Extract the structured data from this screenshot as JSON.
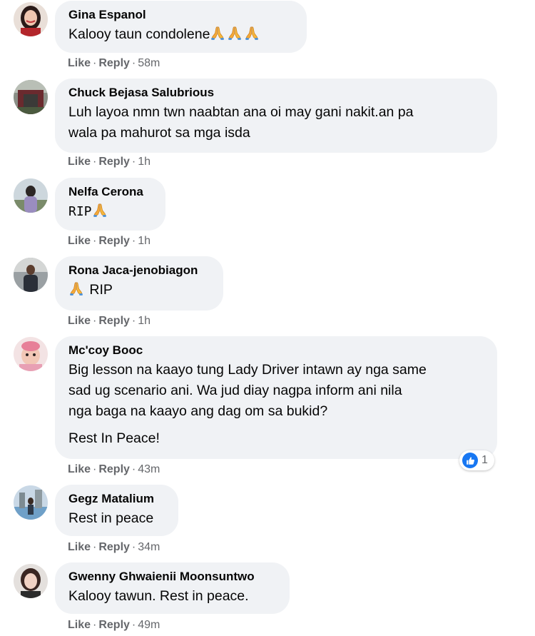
{
  "actions": {
    "like": "Like",
    "reply": "Reply",
    "separator": "·"
  },
  "comments": [
    {
      "author": "Gina Espanol",
      "text_lines": [
        "Kalooy taun condolene"
      ],
      "emoji": "folded-hands x3",
      "time": "58m"
    },
    {
      "author": "Chuck Bejasa Salubrious",
      "text_lines": [
        "Luh layoa nmn twn naabtan ana oi may gani nakit.an pa",
        "wala pa mahurot sa mga isda"
      ],
      "time": "1h"
    },
    {
      "author": "Nelfa Cerona",
      "text_lines": [
        "RIP"
      ],
      "emoji": "folded-hands",
      "time": "1h"
    },
    {
      "author": "Rona Jaca-jenobiagon",
      "text_lines": [
        "RIP"
      ],
      "emoji": "folded-hands",
      "time": "1h"
    },
    {
      "author": "Mc'coy Booc",
      "text_lines": [
        "Big lesson na kaayo tung Lady Driver intawn ay nga same",
        "sad ug scenario ani. Wa jud diay nagpa inform ani nila",
        "nga baga na kaayo ang dag om sa bukid?"
      ],
      "text_extra": "Rest In Peace!",
      "reaction": {
        "icon": "like-icon",
        "count": "1"
      },
      "time": "43m"
    },
    {
      "author": "Gegz Matalium",
      "text_lines": [
        "Rest in peace"
      ],
      "time": "34m"
    },
    {
      "author": "Gwenny Ghwaienii Moonsuntwo",
      "text_lines": [
        "Kalooy tawun. Rest in peace."
      ],
      "time": "49m"
    }
  ],
  "colors": {
    "bubble": "#f0f2f5",
    "meta_text": "#65676b",
    "like_blue": "#1877f2",
    "emoji_yellow": "#f6b73c"
  }
}
